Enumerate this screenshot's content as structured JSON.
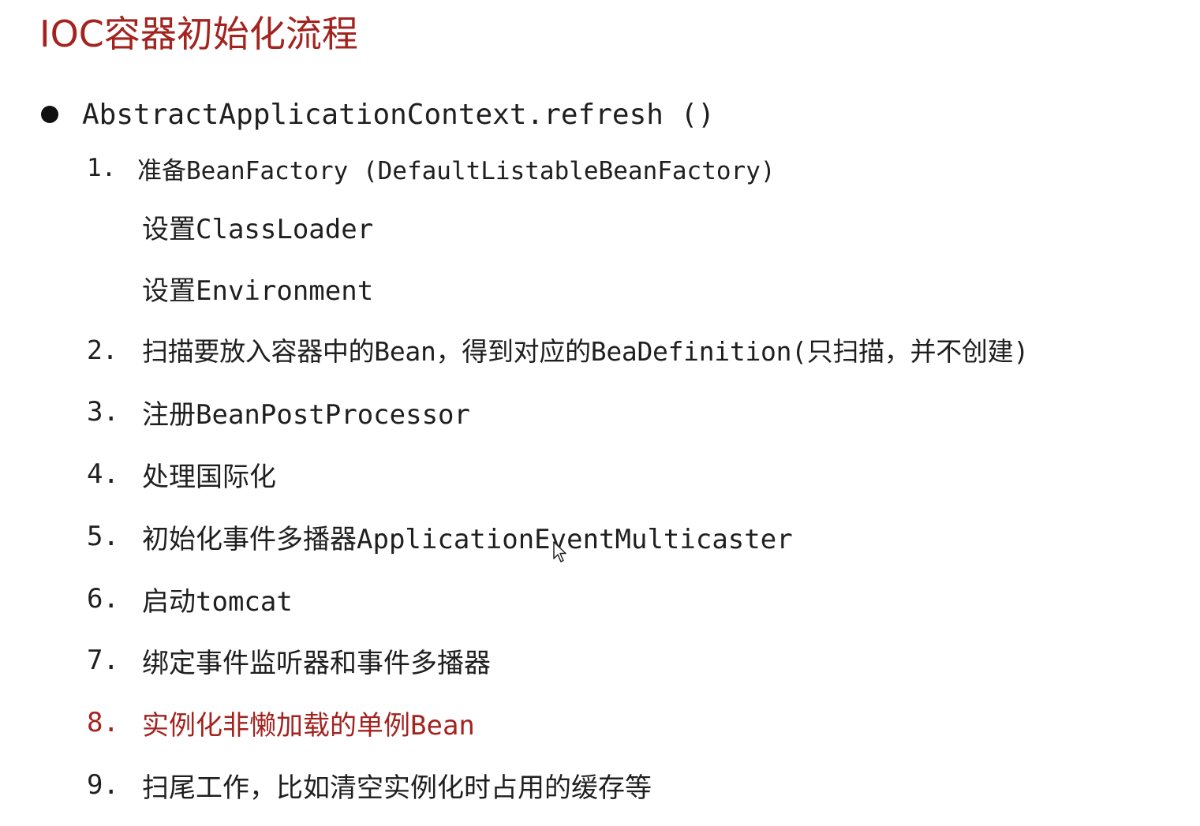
{
  "title": "IOC容器初始化流程",
  "bullet": "AbstractApplicationContext.refresh ()",
  "steps": [
    {
      "num": "1.",
      "text": "准备BeanFactory (DefaultListableBeanFactory)"
    },
    {
      "num": "2.",
      "text": "扫描要放入容器中的Bean，得到对应的BeaDefinition(只扫描，并不创建)"
    },
    {
      "num": "3.",
      "text": "注册BeanPostProcessor"
    },
    {
      "num": "4.",
      "text": "处理国际化"
    },
    {
      "num": "5.",
      "text": "初始化事件多播器ApplicationEventMulticaster"
    },
    {
      "num": "6.",
      "text": "启动tomcat"
    },
    {
      "num": "7.",
      "text": "绑定事件监听器和事件多播器"
    },
    {
      "num": "8.",
      "text": "实例化非懒加载的单例Bean"
    },
    {
      "num": "9.",
      "text": "扫尾工作，比如清空实例化时占用的缓存等"
    }
  ],
  "substeps": [
    "设置ClassLoader",
    "设置Environment"
  ],
  "colors": {
    "accent": "#a3231f",
    "text": "#1f1f1f"
  },
  "icons": {
    "bullet": "filled-circle-icon",
    "pointer": "mouse-pointer-icon"
  }
}
